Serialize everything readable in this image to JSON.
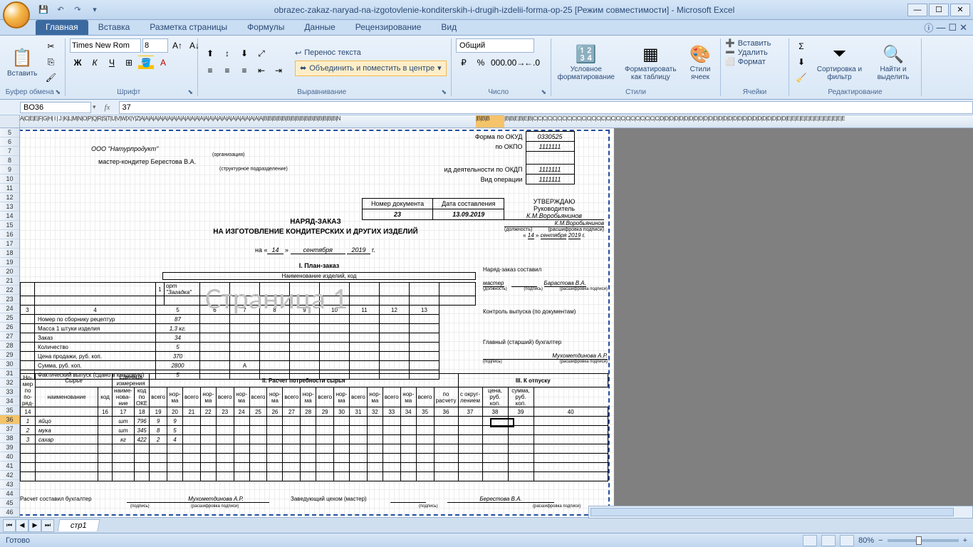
{
  "title": "obrazec-zakaz-naryad-na-izgotovlenie-konditerskih-i-drugih-izdelii-forma-op-25  [Режим совместимости] - Microsoft Excel",
  "tabs": {
    "home": "Главная",
    "insert": "Вставка",
    "layout": "Разметка страницы",
    "formulas": "Формулы",
    "data": "Данные",
    "review": "Рецензирование",
    "view": "Вид"
  },
  "ribbon": {
    "clipboard": {
      "label": "Буфер обмена",
      "paste": "Вставить"
    },
    "font": {
      "label": "Шрифт",
      "name": "Times New Rom",
      "size": "8"
    },
    "alignment": {
      "label": "Выравнивание",
      "wrap": "Перенос текста",
      "merge": "Объединить и поместить в центре"
    },
    "number": {
      "label": "Число",
      "format": "Общий"
    },
    "styles": {
      "label": "Стили",
      "cond": "Условное форматирование",
      "table": "Форматировать как таблицу",
      "cell": "Стили ячеек"
    },
    "cells": {
      "label": "Ячейки",
      "insert": "Вставить",
      "delete": "Удалить",
      "format": "Формат"
    },
    "editing": {
      "label": "Редактирование",
      "sort": "Сортировка и фильтр",
      "find": "Найти и выделить"
    }
  },
  "namebox": "BO36",
  "formula": "37",
  "sheet_tab": "стр1",
  "status": "Готово",
  "zoom": "80%",
  "doc": {
    "form_okud_lbl": "Форма по ОКУД",
    "form_okud": "0330525",
    "okpo_lbl": "по ОКПО",
    "okpo": "1111111",
    "okdp_lbl": "ид деятельности по ОКДП",
    "okdp": "1111111",
    "oper_lbl": "Вид операции",
    "oper": "1111111",
    "org": "ООО \"Натурпродукт\"",
    "org_note": "(организация)",
    "master": "мастер-кондитер Берестова В.А.",
    "struct_note": "(структурное подразделение)",
    "title": "НАРЯД-ЗАКАЗ",
    "subtitle": "НА ИЗГОТОВЛЕНИЕ КОНДИТЕРСКИХ И ДРУГИХ ИЗДЕЛИЙ",
    "date_prefix": "на «",
    "day": "14",
    "month": "сентября",
    "year": "2019",
    "year_suffix": "г.",
    "doc_num_hdr": "Номер документа",
    "doc_date_hdr": "Дата составления",
    "doc_num": "23",
    "doc_date": "13.09.2019",
    "approve": "УТВЕРЖДАЮ",
    "supervisor_lbl": "Руководитель",
    "supervisor": "К.М.Воробьянинов",
    "supervisor2": "К.М.Воробьянинов",
    "position_note": "(должность)",
    "sign_note": "(расшифровка подписи)",
    "section1": "I. План-заказ",
    "subhdr": "Наименование изделий, код",
    "zagadka": "орт \"Загадка\"",
    "rows": {
      "recipe": "Номер по сборнику рецептур",
      "weight": "Масса 1 штуки изделия",
      "zakaz": "Заказ",
      "qty": "Количество",
      "price": "Цена продажи, руб. коп.",
      "sum": "Сумма, руб. коп.",
      "fact": "Фактический выпуск (сдано в кладовую)"
    },
    "vals": {
      "recipe": "87",
      "weight": "1,3 кг.",
      "zakaz": "34",
      "qty": "5",
      "price": "370",
      "sum": "2800",
      "sum_col": "А"
    },
    "right_block": {
      "composed_by": "Наряд-заказ составил",
      "master_lbl": "мастер",
      "master_name": "Барастова В.А.",
      "control": "Контроль выпуска (по документам)",
      "chief": "Главный (старший) бухгалтер",
      "chief_name": "Мухометдинова А.Р."
    },
    "section2": "II. Расчет потребности сырья",
    "section3": "III. К отпуску",
    "tbl2": {
      "nomer": "Но-мер по по-ряд-",
      "syrye": "Сырье",
      "unit": "Единица измерения",
      "naimen": "наименование",
      "kod": "код",
      "naim2": "наиме-нова-ние",
      "kod_okei": "код по ОКЕ",
      "vsego": "всего",
      "norma": "нор-ма",
      "raschet": "по расчету",
      "okrug": "с округ-лением",
      "tsena": "цена, руб. коп.",
      "summa": "сумма, руб. коп."
    },
    "data_rows": [
      {
        "n": "1",
        "name": "яйцо",
        "unit": "шт",
        "code": "796",
        "a": "9",
        "b": "9"
      },
      {
        "n": "2",
        "name": "мука",
        "unit": "шт",
        "code": "345",
        "a": "8",
        "b": "5"
      },
      {
        "n": "3",
        "name": "сахар",
        "unit": "кг",
        "code": "422",
        "a": "2",
        "b": "4"
      }
    ],
    "col_nums": [
      "14",
      "",
      "16",
      "17",
      "18",
      "19",
      "20",
      "21",
      "22",
      "23",
      "24",
      "25",
      "26",
      "27",
      "28",
      "29",
      "30",
      "31",
      "32",
      "33",
      "34",
      "35",
      "36",
      "37",
      "38",
      "39",
      "40"
    ],
    "footer": {
      "composed": "Расчет составил бухгалтер",
      "name1": "Мухометдинова А.Р.",
      "zav": "Заведующий цехом (мастер)",
      "name2": "Берестова В.А."
    },
    "watermark": "Страница 1"
  }
}
